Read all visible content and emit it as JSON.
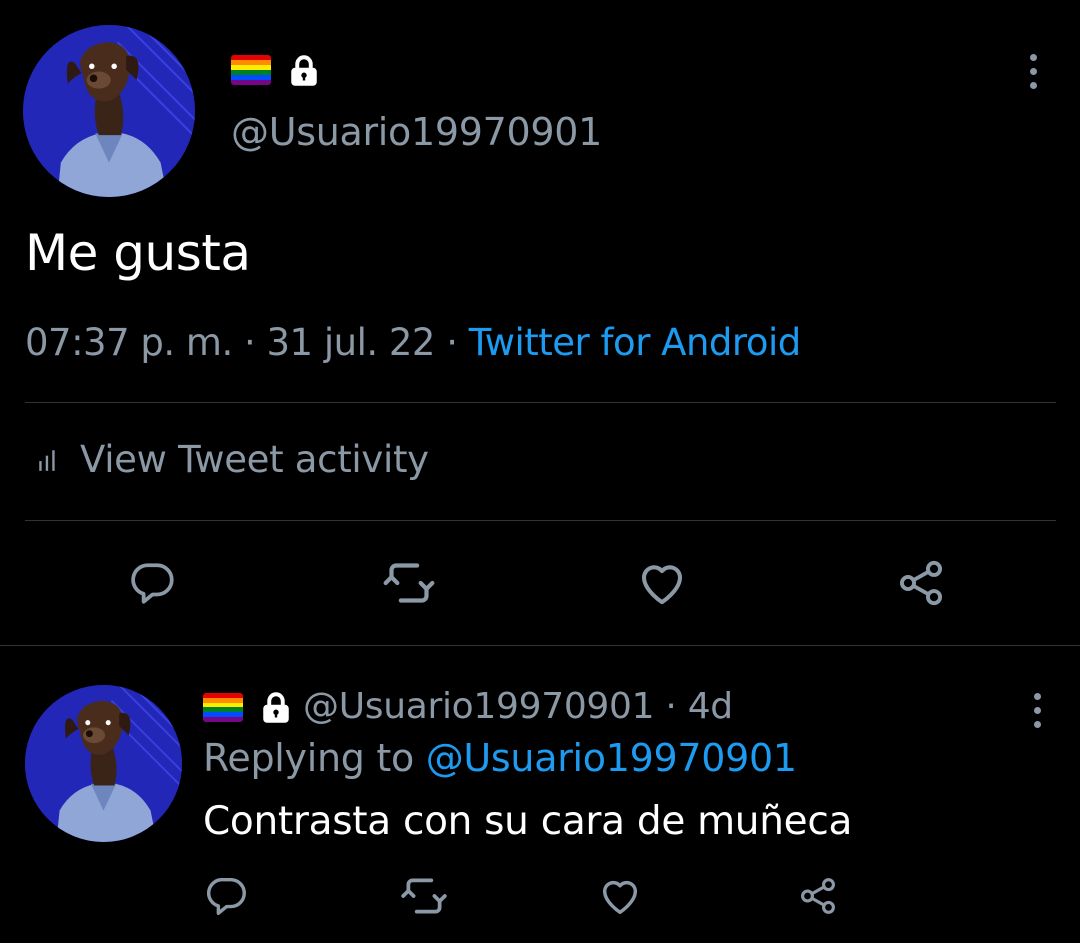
{
  "colors": {
    "background": "#000000",
    "text_primary": "#ffffff",
    "text_secondary": "#8b98a5",
    "link": "#1d9bf0",
    "divider": "#2f3336",
    "avatar_bg": "#2328c0"
  },
  "main_tweet": {
    "handle": "@Usuario19970901",
    "flag_icon": "rainbow-flag",
    "lock_icon": "lock-icon",
    "text": "Me gusta",
    "time": "07:37 p. m.",
    "sep1": " · ",
    "date": "31 jul. 22",
    "sep2": " · ",
    "source": "Twitter for Android",
    "activity_label": "View Tweet activity",
    "actions": [
      "reply-icon",
      "retweet-icon",
      "like-icon",
      "share-icon"
    ]
  },
  "reply_tweet": {
    "handle": "@Usuario19970901",
    "sep": " · ",
    "age": "4d",
    "replying_prefix": "Replying to ",
    "replying_to": "@Usuario19970901",
    "text": "Contrasta con su cara de muñeca",
    "actions": [
      "reply-icon",
      "retweet-icon",
      "like-icon",
      "share-icon"
    ]
  }
}
